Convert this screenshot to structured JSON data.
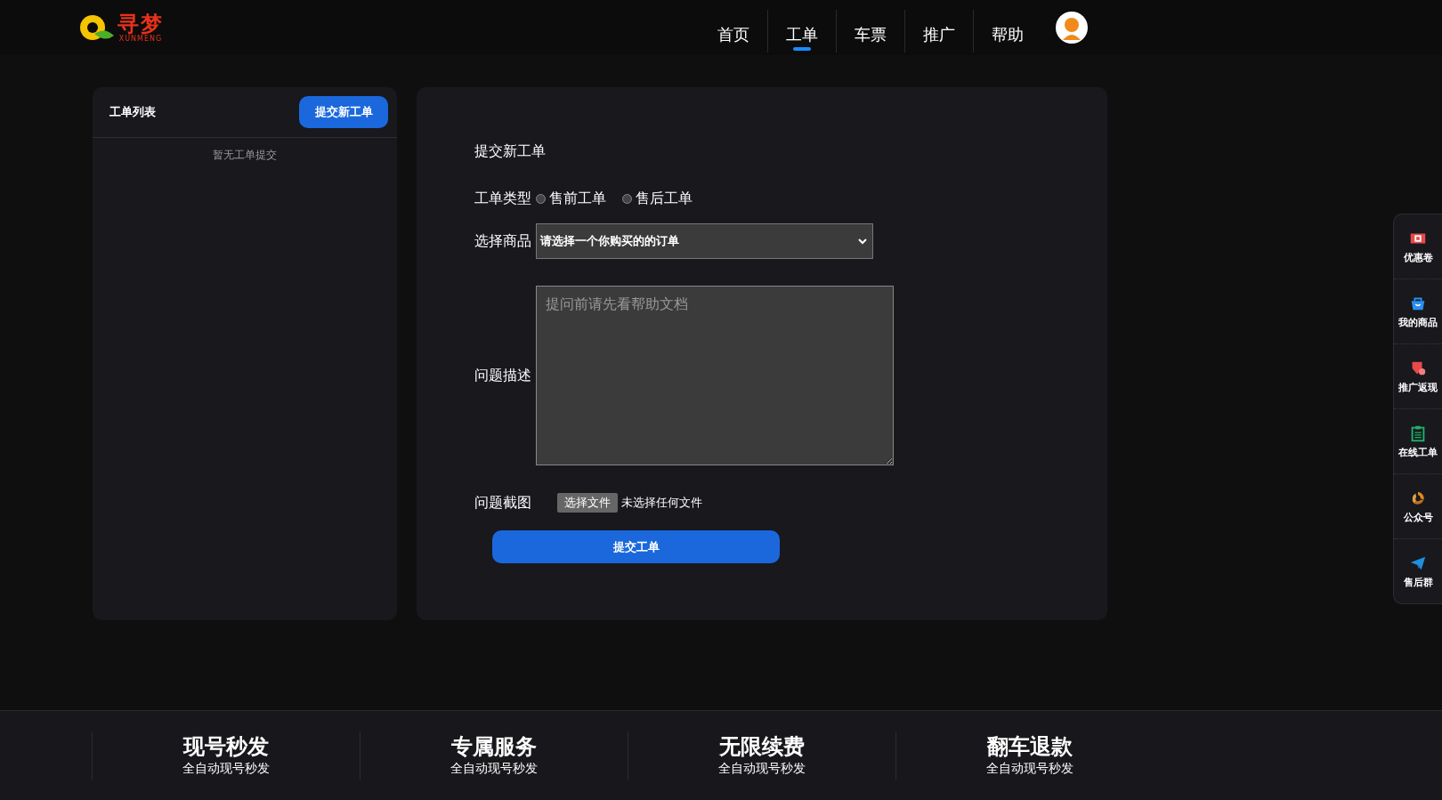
{
  "header": {
    "logo": {
      "mark": "寻梦",
      "subtitle": "XUNMENG"
    },
    "nav": [
      {
        "label": "首页",
        "selected": false
      },
      {
        "label": "工单",
        "selected": true
      },
      {
        "label": "车票",
        "selected": false
      },
      {
        "label": "推广",
        "selected": false
      },
      {
        "label": "帮助",
        "selected": false
      }
    ]
  },
  "ticket_list": {
    "title": "工单列表",
    "new_button": "提交新工单",
    "empty_text": "暂无工单提交"
  },
  "form": {
    "title": "提交新工单",
    "type_label": "工单类型",
    "type_options": [
      {
        "label": "售前工单",
        "selected": false
      },
      {
        "label": "售后工单",
        "selected": false
      }
    ],
    "product_label": "选择商品",
    "product_select": "请选择一个你购买的的订单",
    "description": {
      "label": "问题描述",
      "placeholder": "提问前请先看帮助文档"
    },
    "screenshot_label": "问题截图",
    "file_button": "选择文件",
    "file_status": "未选择任何文件",
    "submit": "提交工单"
  },
  "side_dock": [
    {
      "label": "优惠卷",
      "kind": "coupon"
    },
    {
      "label": "我的商品",
      "kind": "bag"
    },
    {
      "label": "推广返现",
      "kind": "refund"
    },
    {
      "label": "在线工单",
      "kind": "clipboard"
    },
    {
      "label": "公众号",
      "kind": "swirl"
    },
    {
      "label": "售后群",
      "kind": "plane"
    }
  ],
  "features": [
    {
      "title": "现号秒发",
      "subtitle": "全自动现号秒发"
    },
    {
      "title": "专属服务",
      "subtitle": "全自动现号秒发"
    },
    {
      "title": "无限续费",
      "subtitle": "全自动现号秒发"
    },
    {
      "title": "翻车退款",
      "subtitle": "全自动现号秒发"
    }
  ]
}
